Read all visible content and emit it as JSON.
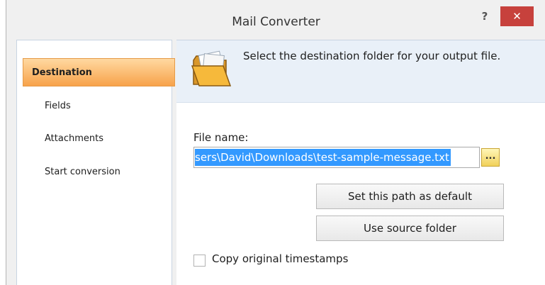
{
  "window": {
    "title": "Mail Converter",
    "help_label": "?",
    "close_label": "✕"
  },
  "sidebar": {
    "items": [
      {
        "label": "Destination"
      },
      {
        "label": "Fields"
      },
      {
        "label": "Attachments"
      },
      {
        "label": "Start conversion"
      }
    ]
  },
  "header": {
    "text": "Select the destination folder for your output file.",
    "icon": "folder-icon"
  },
  "file": {
    "label": "File name:",
    "value": "sers\\David\\Downloads\\test-sample-message.txt",
    "browse_label": "..."
  },
  "buttons": {
    "set_default": "Set this path as default",
    "use_source": "Use source folder"
  },
  "options": {
    "timestamps_label": "Copy original timestamps",
    "timestamps_checked": false
  },
  "colors": {
    "active_item": "#f7a24a",
    "selection": "#3399ff",
    "close_button": "#c7413c",
    "header_band": "#e9f0f8"
  }
}
